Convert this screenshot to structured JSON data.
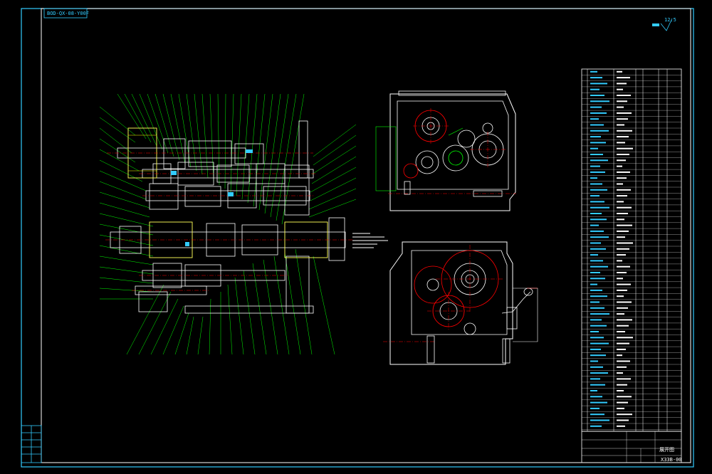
{
  "drawing": {
    "doc_code": "BOD-QX-08-Y00F",
    "roughness_value": "12.5",
    "title_block_name": "展开图",
    "title_block_code": "X33B-00"
  },
  "colors": {
    "background": "#000000",
    "frame": "#ffffff",
    "outline": "#ffffff",
    "leader": "#00ff00",
    "center_line": "#ff0000",
    "accent": "#33ccff",
    "hidden": "#ffff00"
  }
}
